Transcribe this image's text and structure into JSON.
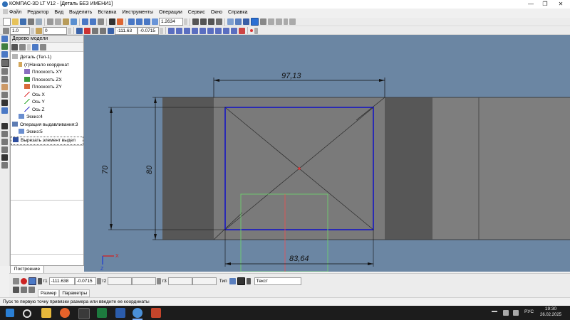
{
  "window": {
    "title": "КОМПАС-3D LT V12 - [Деталь БЕЗ ИМЕНИ1]",
    "min": "—",
    "max": "❐",
    "close": "✕"
  },
  "menu": {
    "items": [
      "Файл",
      "Редактор",
      "Вид",
      "Выделить",
      "Вставка",
      "Инструменты",
      "Операции",
      "Сервис",
      "Окно",
      "Справка"
    ]
  },
  "toolbar1": {
    "zoom_value": "1.2634"
  },
  "toolbar2": {
    "line_scale": "1.0",
    "layer_value": "0",
    "coord_x": "-111.63",
    "coord_y": "-0.0715"
  },
  "tree": {
    "title": "Дерево модели",
    "nodes": [
      {
        "label": "Деталь (Тел-1)",
        "color": "#b5b5b5"
      },
      {
        "label": "(т)Начало координат",
        "color": "#d4a85c"
      },
      {
        "label": "Плоскость XY",
        "color": "#8a6fbf"
      },
      {
        "label": "Плоскость ZX",
        "color": "#3b9a3b"
      },
      {
        "label": "Плоскость ZY",
        "color": "#d96a3a"
      },
      {
        "label": "Ось X",
        "color": "#d33"
      },
      {
        "label": "Ось Y",
        "color": "#3a3"
      },
      {
        "label": "Ось Z",
        "color": "#33c"
      },
      {
        "label": "Эскиз:4",
        "color": "#6a8ecf"
      },
      {
        "label": "Операция выдавливания:3",
        "color": "#5d7cb3"
      },
      {
        "label": "Эскиз:5",
        "color": "#6a8ecf"
      },
      {
        "label": "Вырезать элемент выдел",
        "color": "#2f4f9f"
      }
    ],
    "tab_label": "Построение"
  },
  "drawing": {
    "dim_width_top": "97,13",
    "dim_height_inner": "70",
    "dim_height_outer": "80",
    "dim_width_bottom": "83,64",
    "axis_x": "X",
    "axis_z": "Z"
  },
  "props": {
    "t1_label": "т1",
    "t1_x": "-111.638",
    "t1_y": "-0.0715",
    "t2_label": "т2",
    "t3_label": "т3",
    "type_label": "Тип",
    "text_label": "Текст",
    "tab_size": "Размер",
    "tab_params": "Параметры"
  },
  "status": {
    "text": "Пуск  те первую точку привязки размера или введите ее координаты"
  },
  "taskbar": {
    "lang": "РУС",
    "time": "19:30",
    "date": "26.02.2025"
  }
}
